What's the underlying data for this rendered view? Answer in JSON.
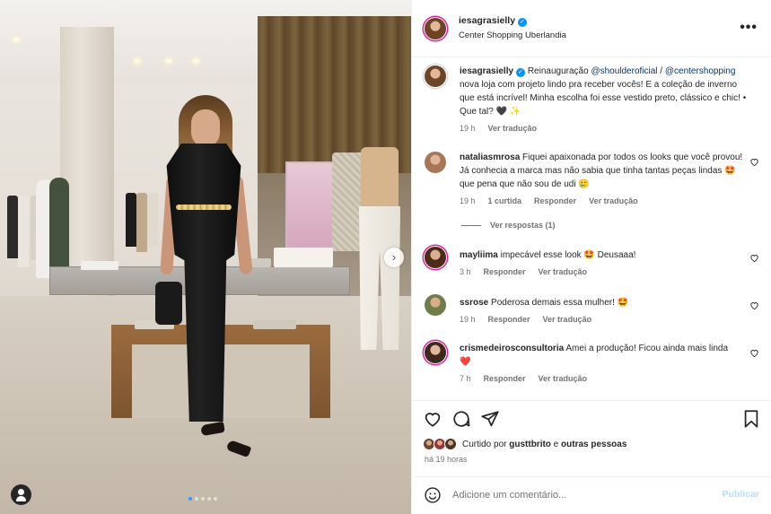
{
  "post": {
    "username": "iesagrasielly",
    "location": "Center Shopping Uberlandia",
    "caption": {
      "pre": "Reinauguração ",
      "mention1": "@shoulderoficial",
      "mid": " / ",
      "mention2": "@centershopping",
      "post": " nova loja com projeto lindo pra receber vocês! E a coleção de inverno que está incrível! Minha escolha foi esse vestido preto, clássico e chic! • Que tal? 🖤 ✨",
      "time": "19 h",
      "translate": "Ver tradução"
    },
    "carousel_total": 5,
    "carousel_active": 1
  },
  "comments": [
    {
      "user": "nataliasmrosa",
      "text": "Fiquei apaixonada por todos os looks que você provou! Já conhecia a marca mas não sabia que tinha tantas peças lindas 🤩 que pena que não sou de udi 🥲",
      "time": "19 h",
      "likes": "1 curtida",
      "reply": "Responder",
      "translate": "Ver tradução",
      "replies": "Ver respostas (1)"
    },
    {
      "user": "mayliima",
      "text": "impecável esse look 🤩 Deusaaa!",
      "time": "3 h",
      "reply": "Responder",
      "translate": "Ver tradução"
    },
    {
      "user": "ssrose",
      "text": "Poderosa demais essa mulher! 🤩",
      "time": "19 h",
      "reply": "Responder",
      "translate": "Ver tradução"
    },
    {
      "user": "crismedeirosconsultoria",
      "text": "Amei a produção! Ficou ainda mais linda ❤️",
      "time": "7 h",
      "reply": "Responder",
      "translate": "Ver tradução"
    }
  ],
  "likes": {
    "prefix": "Curtido por ",
    "user": "gusttbrito",
    "mid": " e ",
    "others": "outras pessoas"
  },
  "timestamp": "há 19 horas",
  "composer": {
    "placeholder": "Adicione um comentário...",
    "publish": "Publicar"
  },
  "colors": {
    "accent": "#0095f6",
    "link": "#00376b",
    "muted": "#737373",
    "publish_disabled": "#b2dffc"
  },
  "icons": [
    "more-icon",
    "heart-icon",
    "comment-icon",
    "share-icon",
    "bookmark-icon",
    "emoji-icon",
    "verified-icon",
    "user-tag-icon",
    "chevron-right-icon"
  ]
}
